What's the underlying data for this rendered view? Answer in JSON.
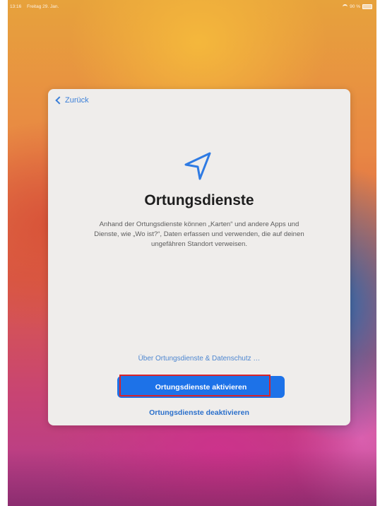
{
  "status_bar": {
    "time": "13:16",
    "date": "Freitag 29. Jan.",
    "battery": "90 %"
  },
  "setup_screen": {
    "back_label": "Zurück",
    "icon": "location-arrow-icon",
    "title": "Ortungsdienste",
    "description": "Anhand der Ortungsdienste können „Karten“ und andere Apps und Dienste, wie „Wo ist?“, Daten erfassen und verwenden, die auf deinen ungefähren Standort verweisen.",
    "privacy_link": "Über Ortungsdienste & Datenschutz …",
    "primary_button": "Ortungsdienste aktivieren",
    "secondary_link": "Ortungsdienste deaktivieren"
  },
  "colors": {
    "accent": "#1d72e8",
    "highlight_box": "#d8242b",
    "card_background": "#efedeb"
  }
}
